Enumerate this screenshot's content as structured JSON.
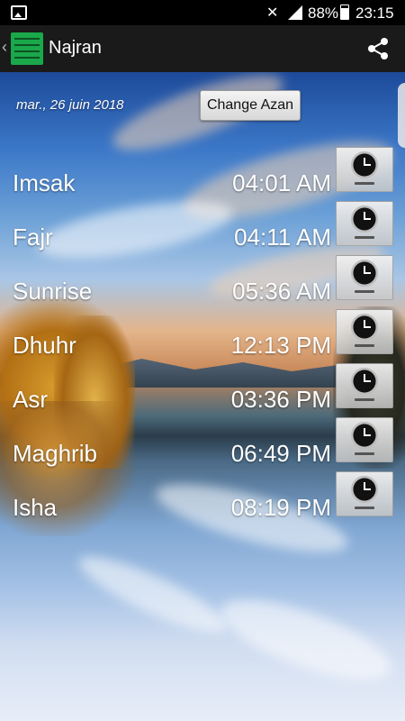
{
  "status_bar": {
    "battery": "88%",
    "time": "23:15"
  },
  "app_bar": {
    "title": "Najran",
    "icons": [
      "back-arrow-icon",
      "app-logo",
      "share-icon"
    ]
  },
  "header": {
    "date": "mar., 26 juin 2018",
    "change_azan_label": "Change Azan"
  },
  "prayers": [
    {
      "name": "Imsak",
      "time": "04:01 AM"
    },
    {
      "name": "Fajr",
      "time": "04:11 AM"
    },
    {
      "name": "Sunrise",
      "time": "05:36 AM"
    },
    {
      "name": "Dhuhr",
      "time": "12:13 PM"
    },
    {
      "name": "Asr",
      "time": "03:36 PM"
    },
    {
      "name": "Maghrib",
      "time": "06:49 PM"
    },
    {
      "name": "Isha",
      "time": "08:19 PM"
    }
  ],
  "colors": {
    "app_bar": "#1a1a1a",
    "logo_green": "#1aa84a",
    "text": "#ffffff"
  }
}
